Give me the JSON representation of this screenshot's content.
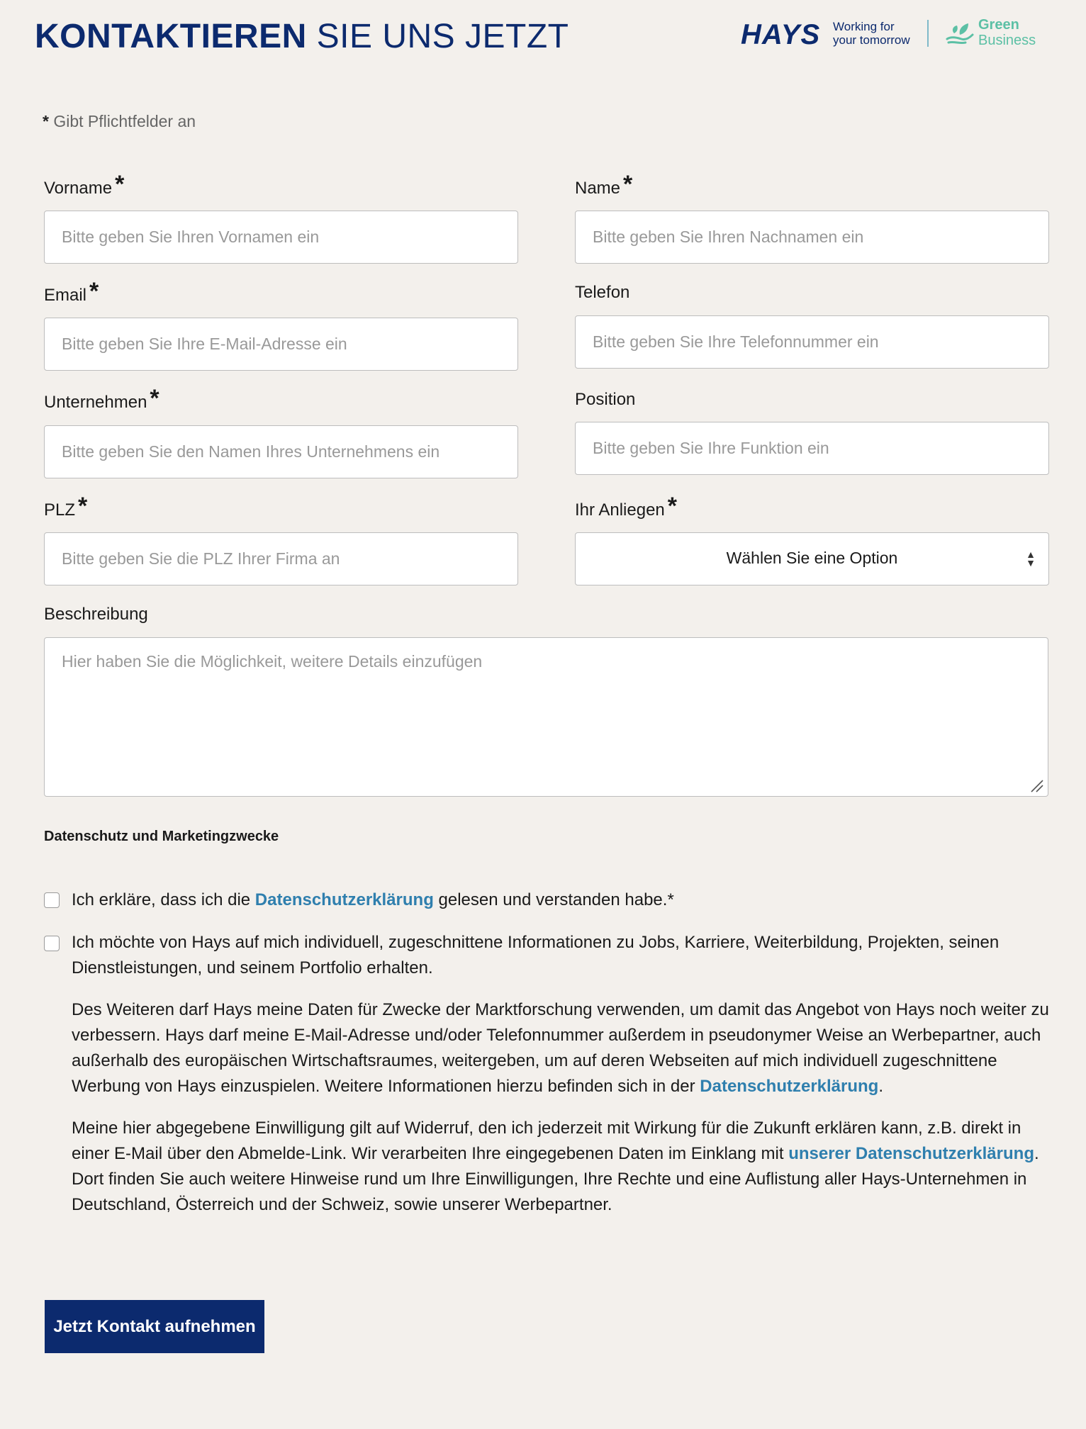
{
  "header": {
    "title_bold": "KONTAKTIEREN",
    "title_light": "SIE UNS JETZT",
    "logo_hays": "HAYS",
    "tagline_line1": "Working for",
    "tagline_line2": "your tomorrow",
    "green_line1": "Green",
    "green_line2": "Business"
  },
  "required_note": {
    "asterisk": "*",
    "text": "Gibt Pflichtfelder an"
  },
  "fields": {
    "vorname": {
      "label": "Vorname",
      "required": "*",
      "placeholder": "Bitte geben Sie Ihren Vornamen ein"
    },
    "name": {
      "label": "Name",
      "required": "*",
      "placeholder": "Bitte geben Sie Ihren Nachnamen ein"
    },
    "email": {
      "label": "Email",
      "required": "*",
      "placeholder": "Bitte geben Sie Ihre E-Mail-Adresse ein"
    },
    "telefon": {
      "label": "Telefon",
      "placeholder": "Bitte geben Sie Ihre Telefonnummer ein"
    },
    "unternehmen": {
      "label": "Unternehmen",
      "required": "*",
      "placeholder": "Bitte geben Sie den Namen Ihres Unternehmens ein"
    },
    "position": {
      "label": "Position",
      "placeholder": "Bitte geben Sie Ihre Funktion ein"
    },
    "plz": {
      "label": "PLZ",
      "required": "*",
      "placeholder": "Bitte geben Sie die PLZ Ihrer Firma an"
    },
    "anliegen": {
      "label": "Ihr Anliegen",
      "required": "*",
      "selected": "Wählen Sie eine Option"
    },
    "beschreibung": {
      "label": "Beschreibung",
      "placeholder": "Hier haben Sie die Möglichkeit, weitere Details einzufügen"
    }
  },
  "privacy": {
    "heading": "Datenschutz und Marketingzwecke",
    "consent1": {
      "before": "Ich erkläre, dass ich die ",
      "link": "Datenschutzerklärung",
      "after": " gelesen und verstanden habe.*"
    },
    "consent2": {
      "text": "Ich möchte von Hays auf mich individuell, zugeschnittene Informationen zu Jobs, Karriere, Weiterbildung, Projekten, seinen Dienstleistungen, und seinem Portfolio erhalten."
    },
    "para1": {
      "text": "Des Weiteren darf Hays meine Daten für Zwecke der Marktforschung verwenden, um damit das Angebot von Hays noch weiter zu verbessern. Hays darf meine E-Mail-Adresse und/oder Telefonnummer außerdem in pseudonymer Weise an Werbepartner, auch außerhalb des europäischen Wirtschaftsraumes, weitergeben, um auf deren Webseiten auf mich individuell zugeschnittene Werbung von Hays einzuspielen. Weitere Informationen hierzu befinden sich in der ",
      "link": "Datenschutzerklärung",
      "after": "."
    },
    "para2": {
      "text": "Meine hier abgegebene Einwilligung gilt auf Widerruf, den ich jederzeit mit Wirkung für die Zukunft erklären kann, z.B. direkt in einer E-Mail über den Abmelde-Link. Wir verarbeiten Ihre eingegebenen Daten im Einklang mit ",
      "link": "unserer Datenschutzerklärung",
      "after": ". Dort finden Sie auch weitere Hinweise rund um Ihre Einwilligungen, Ihre Rechte und eine Auflistung aller Hays-Unternehmen in Deutschland, Österreich und der Schweiz, sowie unserer Werbepartner."
    }
  },
  "submit_label": "Jetzt Kontakt aufnehmen",
  "colors": {
    "brand_navy": "#0c2a6e",
    "link_blue": "#2f7fae",
    "green": "#5cc0a5",
    "background": "#f3f0ec"
  }
}
